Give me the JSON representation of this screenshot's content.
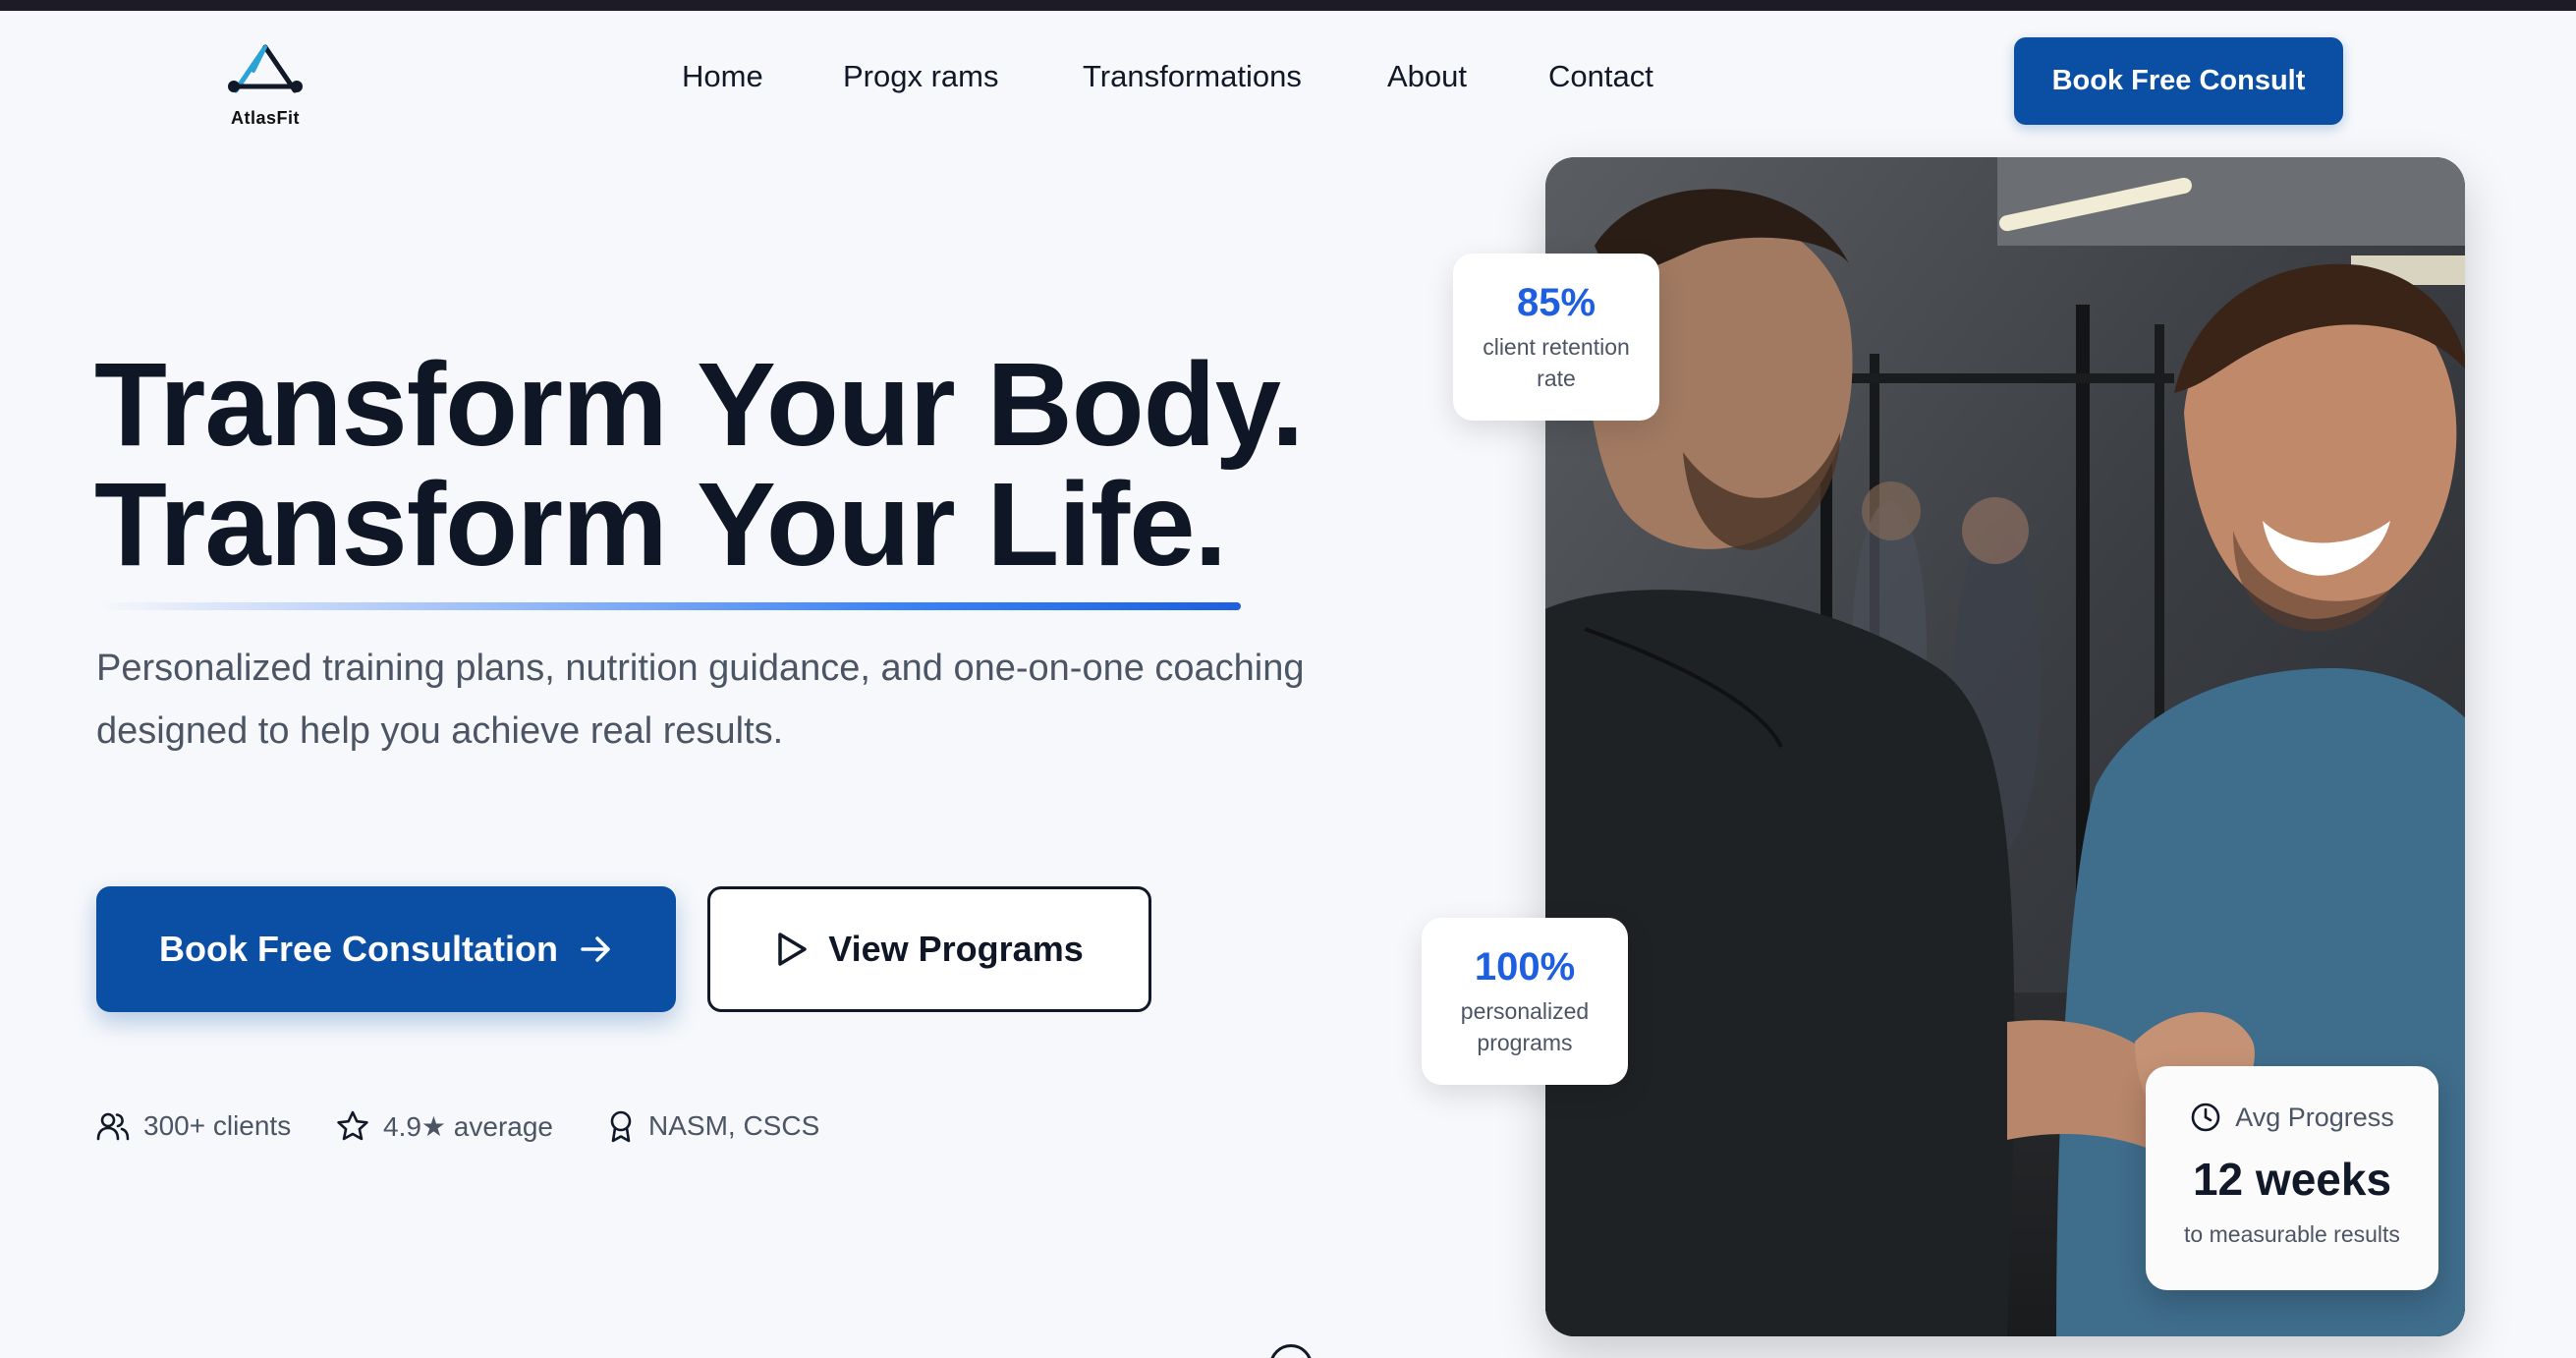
{
  "brand": {
    "name": "AtlasFit"
  },
  "nav": {
    "items": [
      {
        "label": "Home"
      },
      {
        "label": "Progx rams"
      },
      {
        "label": "Transformations"
      },
      {
        "label": "About"
      },
      {
        "label": "Contact"
      }
    ],
    "cta": "Book Free Consult"
  },
  "hero": {
    "headline_line1": "Transform Your Body.",
    "headline_line2": "Transform Your Life.",
    "subhead": "Personalized training plans, nutrition guidance, and one-on-one coaching designed to help you achieve real results.",
    "primary_cta": "Book Free Consultation",
    "secondary_cta": "View Programs",
    "trust": [
      {
        "icon": "users-icon",
        "label": "300+ clients"
      },
      {
        "icon": "star-icon",
        "label": "4.9★ average"
      },
      {
        "icon": "award-icon",
        "label": "NASM, CSCS"
      }
    ]
  },
  "stats": {
    "retention": {
      "value": "85%",
      "label_line1": "client retention",
      "label_line2": "rate"
    },
    "personalized": {
      "value": "100%",
      "label_line1": "personalized",
      "label_line2": "programs"
    },
    "progress": {
      "title": "Avg Progress",
      "value": "12 weeks",
      "subtitle": "to measurable results",
      "icon": "clock-icon"
    }
  },
  "colors": {
    "primary": "#0b4fa5",
    "accent": "#1d5fe0",
    "heading": "#0f1727",
    "body_text": "#4b5563",
    "background": "#f6f8fb"
  }
}
